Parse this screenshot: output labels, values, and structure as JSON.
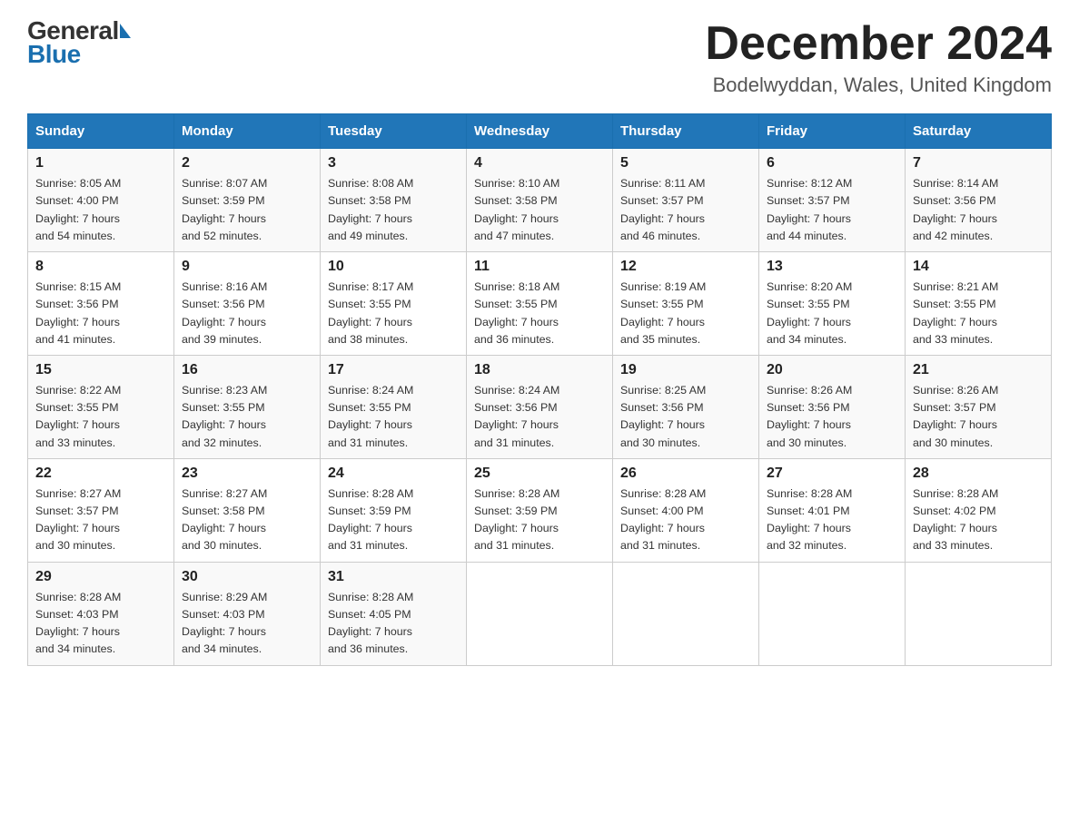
{
  "header": {
    "logo_general": "General",
    "logo_blue": "Blue",
    "month_title": "December 2024",
    "location": "Bodelwyddan, Wales, United Kingdom"
  },
  "days_of_week": [
    "Sunday",
    "Monday",
    "Tuesday",
    "Wednesday",
    "Thursday",
    "Friday",
    "Saturday"
  ],
  "weeks": [
    [
      {
        "day": "1",
        "sunrise": "8:05 AM",
        "sunset": "4:00 PM",
        "daylight": "7 hours and 54 minutes."
      },
      {
        "day": "2",
        "sunrise": "8:07 AM",
        "sunset": "3:59 PM",
        "daylight": "7 hours and 52 minutes."
      },
      {
        "day": "3",
        "sunrise": "8:08 AM",
        "sunset": "3:58 PM",
        "daylight": "7 hours and 49 minutes."
      },
      {
        "day": "4",
        "sunrise": "8:10 AM",
        "sunset": "3:58 PM",
        "daylight": "7 hours and 47 minutes."
      },
      {
        "day": "5",
        "sunrise": "8:11 AM",
        "sunset": "3:57 PM",
        "daylight": "7 hours and 46 minutes."
      },
      {
        "day": "6",
        "sunrise": "8:12 AM",
        "sunset": "3:57 PM",
        "daylight": "7 hours and 44 minutes."
      },
      {
        "day": "7",
        "sunrise": "8:14 AM",
        "sunset": "3:56 PM",
        "daylight": "7 hours and 42 minutes."
      }
    ],
    [
      {
        "day": "8",
        "sunrise": "8:15 AM",
        "sunset": "3:56 PM",
        "daylight": "7 hours and 41 minutes."
      },
      {
        "day": "9",
        "sunrise": "8:16 AM",
        "sunset": "3:56 PM",
        "daylight": "7 hours and 39 minutes."
      },
      {
        "day": "10",
        "sunrise": "8:17 AM",
        "sunset": "3:55 PM",
        "daylight": "7 hours and 38 minutes."
      },
      {
        "day": "11",
        "sunrise": "8:18 AM",
        "sunset": "3:55 PM",
        "daylight": "7 hours and 36 minutes."
      },
      {
        "day": "12",
        "sunrise": "8:19 AM",
        "sunset": "3:55 PM",
        "daylight": "7 hours and 35 minutes."
      },
      {
        "day": "13",
        "sunrise": "8:20 AM",
        "sunset": "3:55 PM",
        "daylight": "7 hours and 34 minutes."
      },
      {
        "day": "14",
        "sunrise": "8:21 AM",
        "sunset": "3:55 PM",
        "daylight": "7 hours and 33 minutes."
      }
    ],
    [
      {
        "day": "15",
        "sunrise": "8:22 AM",
        "sunset": "3:55 PM",
        "daylight": "7 hours and 33 minutes."
      },
      {
        "day": "16",
        "sunrise": "8:23 AM",
        "sunset": "3:55 PM",
        "daylight": "7 hours and 32 minutes."
      },
      {
        "day": "17",
        "sunrise": "8:24 AM",
        "sunset": "3:55 PM",
        "daylight": "7 hours and 31 minutes."
      },
      {
        "day": "18",
        "sunrise": "8:24 AM",
        "sunset": "3:56 PM",
        "daylight": "7 hours and 31 minutes."
      },
      {
        "day": "19",
        "sunrise": "8:25 AM",
        "sunset": "3:56 PM",
        "daylight": "7 hours and 30 minutes."
      },
      {
        "day": "20",
        "sunrise": "8:26 AM",
        "sunset": "3:56 PM",
        "daylight": "7 hours and 30 minutes."
      },
      {
        "day": "21",
        "sunrise": "8:26 AM",
        "sunset": "3:57 PM",
        "daylight": "7 hours and 30 minutes."
      }
    ],
    [
      {
        "day": "22",
        "sunrise": "8:27 AM",
        "sunset": "3:57 PM",
        "daylight": "7 hours and 30 minutes."
      },
      {
        "day": "23",
        "sunrise": "8:27 AM",
        "sunset": "3:58 PM",
        "daylight": "7 hours and 30 minutes."
      },
      {
        "day": "24",
        "sunrise": "8:28 AM",
        "sunset": "3:59 PM",
        "daylight": "7 hours and 31 minutes."
      },
      {
        "day": "25",
        "sunrise": "8:28 AM",
        "sunset": "3:59 PM",
        "daylight": "7 hours and 31 minutes."
      },
      {
        "day": "26",
        "sunrise": "8:28 AM",
        "sunset": "4:00 PM",
        "daylight": "7 hours and 31 minutes."
      },
      {
        "day": "27",
        "sunrise": "8:28 AM",
        "sunset": "4:01 PM",
        "daylight": "7 hours and 32 minutes."
      },
      {
        "day": "28",
        "sunrise": "8:28 AM",
        "sunset": "4:02 PM",
        "daylight": "7 hours and 33 minutes."
      }
    ],
    [
      {
        "day": "29",
        "sunrise": "8:28 AM",
        "sunset": "4:03 PM",
        "daylight": "7 hours and 34 minutes."
      },
      {
        "day": "30",
        "sunrise": "8:29 AM",
        "sunset": "4:03 PM",
        "daylight": "7 hours and 34 minutes."
      },
      {
        "day": "31",
        "sunrise": "8:28 AM",
        "sunset": "4:05 PM",
        "daylight": "7 hours and 36 minutes."
      },
      null,
      null,
      null,
      null
    ]
  ],
  "labels": {
    "sunrise": "Sunrise:",
    "sunset": "Sunset:",
    "daylight": "Daylight:"
  }
}
